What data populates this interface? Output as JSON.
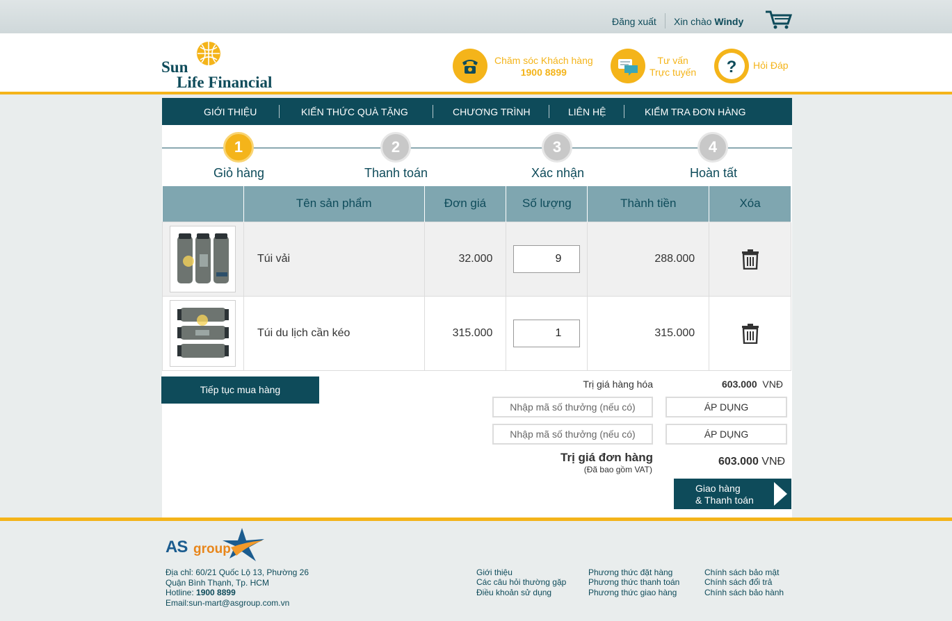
{
  "topbar": {
    "logout": "Đăng xuất",
    "greeting_prefix": "Xin chào",
    "username": "Windy"
  },
  "header": {
    "logo_line1": "Sun",
    "logo_line2": "Life Financial",
    "support_label": "Chăm sóc Khách hàng",
    "support_phone": "1900 8899",
    "consult_line1": "Tư vấn",
    "consult_line2": "Trực tuyến",
    "faq_label": "Hỏi Đáp"
  },
  "nav": {
    "items": [
      "GIỚI THIỆU",
      "KIẾN THỨC QUÀ TẶNG",
      "CHƯƠNG TRÌNH",
      "LIÊN HỆ",
      "KIỂM TRA ĐƠN HÀNG"
    ]
  },
  "steps": [
    {
      "number": "1",
      "label": "Giỏ hàng"
    },
    {
      "number": "2",
      "label": "Thanh toán"
    },
    {
      "number": "3",
      "label": "Xác nhận"
    },
    {
      "number": "4",
      "label": "Hoàn tất"
    }
  ],
  "cart": {
    "headers": [
      "Tên sản phẩm",
      "Đơn giá",
      "Số lượng",
      "Thành tiền",
      "Xóa"
    ],
    "rows": [
      {
        "name": "Túi vải",
        "price": "32.000",
        "qty": "9",
        "total": "288.000"
      },
      {
        "name": "Túi du lịch cần kéo",
        "price": "315.000",
        "qty": "1",
        "total": "315.000"
      }
    ]
  },
  "summary": {
    "continue_label": "Tiếp tục mua hàng",
    "subtotal_label": "Trị giá hàng hóa",
    "subtotal_value": "603.000",
    "currency": "VNĐ",
    "coupon_placeholder": "Nhập mã số thưởng (nếu có)",
    "apply_label": "ÁP DỤNG",
    "order_total_label": "Trị giá đơn hàng",
    "vat_note": "(Đã bao gồm VAT)",
    "order_total_value": "603.000",
    "checkout_line1": "Giao hàng",
    "checkout_line2": "& Thanh toán"
  },
  "footer": {
    "logo_as": "AS",
    "logo_group": "group",
    "address_line1": "Địa chỉ: 60/21 Quốc Lộ 13, Phường 26",
    "address_line2": "Quận Bình Thạnh, Tp. HCM",
    "hotline_label": "Hotline:",
    "hotline_value": "1900 8899",
    "email": "Email:sun-mart@asgroup.com.vn",
    "col1": [
      "Giới thiệu",
      "Các câu hỏi thường gặp",
      "Điều khoản sử dụng"
    ],
    "col2": [
      "Phương thức đặt hàng",
      "Phương thức thanh toán",
      "Phương thức giao hàng"
    ],
    "col3": [
      "Chính sách bảo mật",
      "Chính sách đổi trả",
      "Chính sách bảo hành"
    ]
  },
  "colors": {
    "brand_teal": "#0e4b5a",
    "brand_yellow": "#f4b41a",
    "table_header": "#7fa6b0"
  }
}
